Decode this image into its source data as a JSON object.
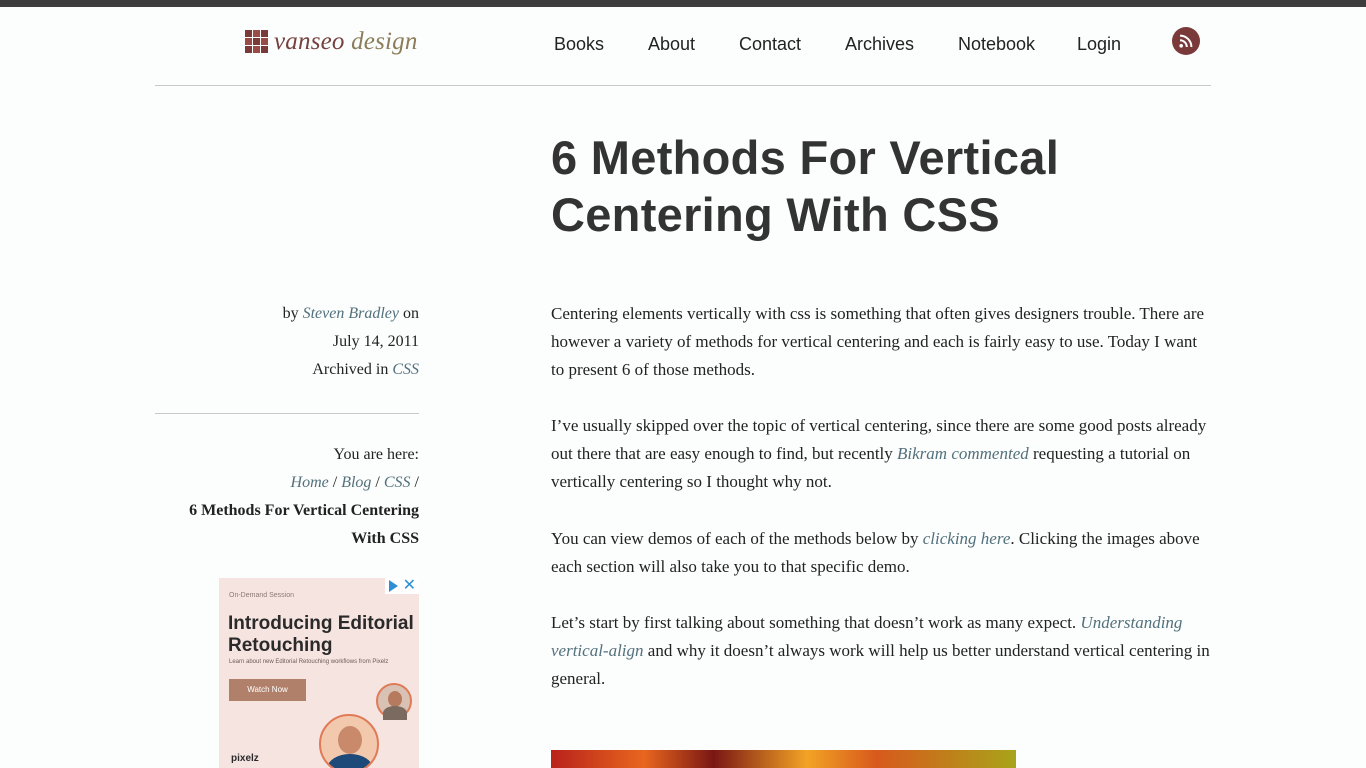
{
  "site": {
    "logo_main": "vanseo",
    "logo_light": " design"
  },
  "nav": {
    "items": [
      "Books",
      "About",
      "Contact",
      "Archives",
      "Notebook",
      "Login"
    ]
  },
  "article": {
    "title": "6 Methods For Vertical Centering With CSS",
    "byline": {
      "by": "by",
      "author": "Steven Bradley",
      "on": "on",
      "date": "July 14, 2011",
      "archived_in": "Archived in",
      "category": "CSS"
    },
    "breadcrumb": {
      "label": "You are here:",
      "home": "Home",
      "blog": "Blog",
      "css": "CSS",
      "sep": "/",
      "current": "6 Methods For Vertical Centering With CSS"
    },
    "paragraphs": {
      "p1": "Centering elements vertically with css is something that often gives designers trouble. There are however a variety of methods for vertical centering and each is fairly easy to use. Today I want to present 6 of those methods.",
      "p2_a": "I’ve usually skipped over the topic of vertical centering, since there are some good posts already out there that are easy enough to find, but recently ",
      "p2_link": "Bikram commented",
      "p2_b": " requesting a tutorial on vertically centering so I thought why not.",
      "p3_a": "You can view demos of each of the methods below by ",
      "p3_link": "clicking here",
      "p3_b": ". Clicking the images above each section will also take you to that specific demo.",
      "p4_a": "Let’s start by first talking about something that doesn’t work as many expect. ",
      "p4_link": "Understanding vertical-align",
      "p4_b": " and why it doesn’t always work will help us better understand vertical centering in general."
    }
  },
  "ad": {
    "kicker": "On-Demand Session",
    "headline": "Introducing Editorial Retouching",
    "sub": "Learn about new Editorial Retouching workflows from Pixelz",
    "button": "Watch Now",
    "brand": "pixelz",
    "close": "✕"
  }
}
